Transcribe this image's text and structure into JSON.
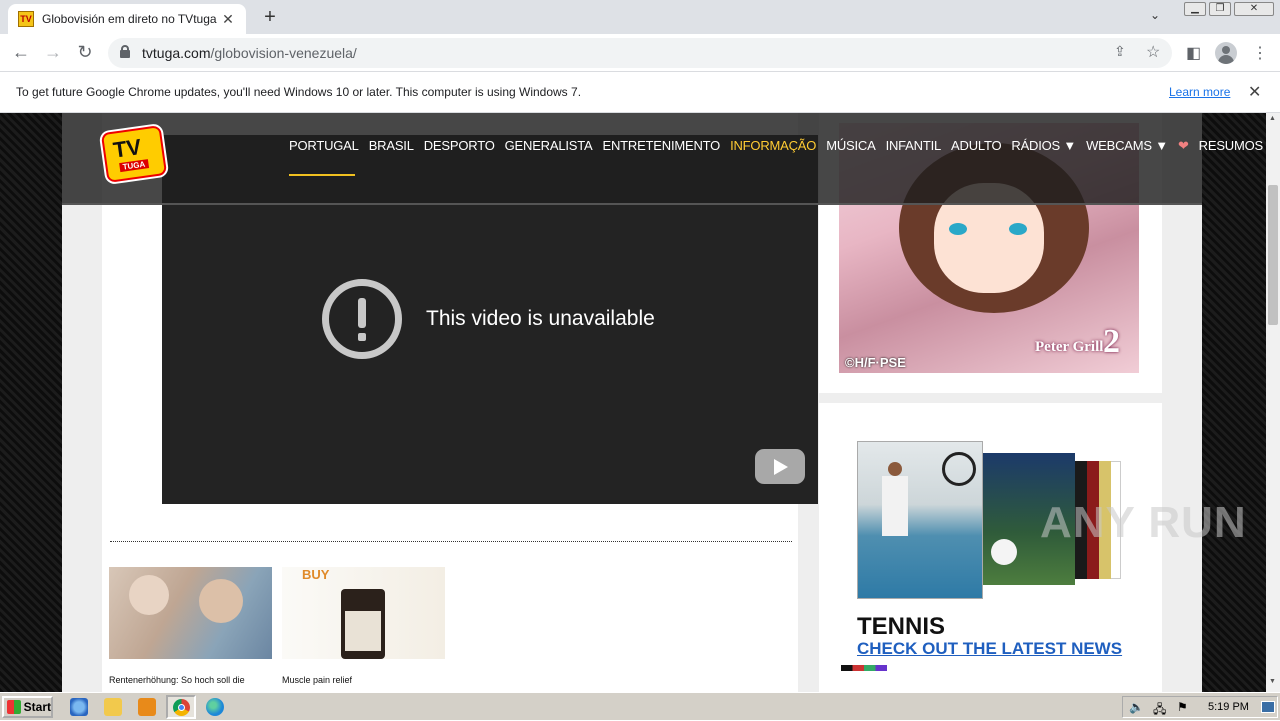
{
  "browser": {
    "tab_title": "Globovisión em direto no TVtuga",
    "tab_favicon": "TV",
    "url_host": "tvtuga.com",
    "url_path": "/globovision-venezuela/"
  },
  "infobar": {
    "message": "To get future Google Chrome updates, you'll need Windows 10 or later. This computer is using Windows 7.",
    "learn_more": "Learn more"
  },
  "site": {
    "logo_tv": "TV",
    "logo_tuga": "TUGA",
    "menu": [
      "PORTUGAL",
      "BRASIL",
      "DESPORTO",
      "GENERALISTA",
      "ENTRETENIMENTO",
      "INFORMAÇÃO",
      "MÚSICA",
      "INFANTIL",
      "ADULTO",
      "RÁDIOS ▼",
      "WEBCAMS ▼",
      "❤",
      "RESUMOS FUTEBOL"
    ],
    "active_menu": "INFORMAÇÃO",
    "accent_color": "#ffcc33"
  },
  "video": {
    "message": "This video is unavailable"
  },
  "related": [
    {
      "caption": "Rentenerhöhung: So hoch soll die"
    },
    {
      "caption": "Muscle pain relief",
      "badge": "BUY"
    }
  ],
  "ads": {
    "anime_copyright": "©H/F·PSE",
    "anime_title": "Peter Grill",
    "anime_number": "2",
    "tennis_title": "TENNIS",
    "tennis_link": "CHECK OUT THE LATEST NEWS"
  },
  "watermark": "ANY RUN",
  "taskbar": {
    "start": "Start",
    "clock": "5:19 PM"
  }
}
